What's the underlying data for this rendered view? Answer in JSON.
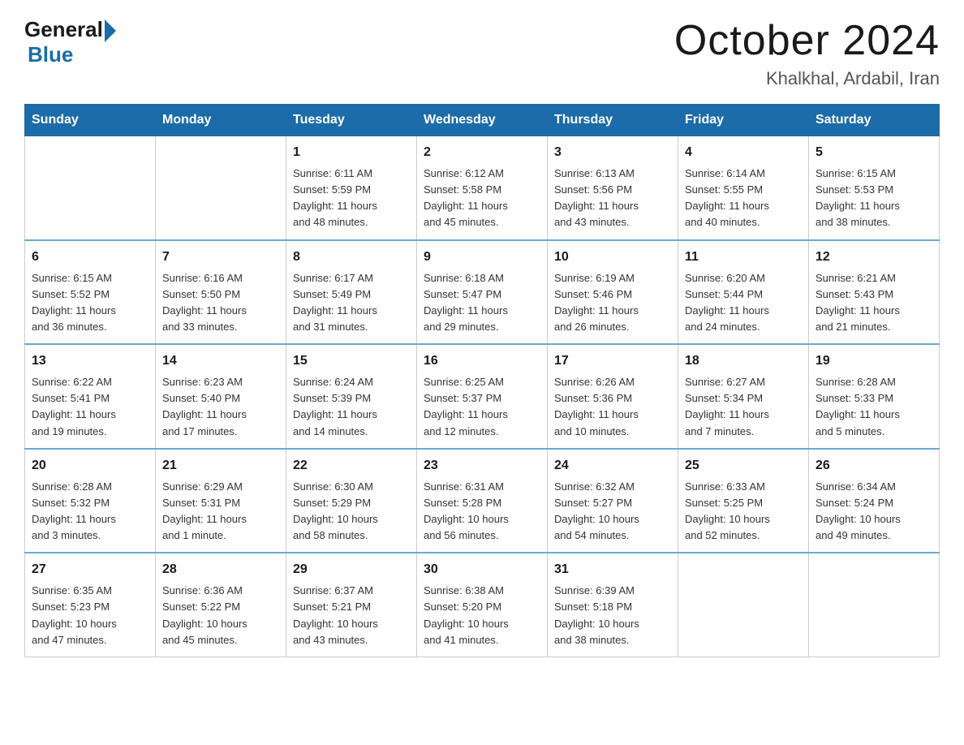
{
  "header": {
    "logo_general": "General",
    "logo_blue": "Blue",
    "title": "October 2024",
    "subtitle": "Khalkhal, Ardabil, Iran"
  },
  "weekdays": [
    "Sunday",
    "Monday",
    "Tuesday",
    "Wednesday",
    "Thursday",
    "Friday",
    "Saturday"
  ],
  "weeks": [
    [
      {
        "day": "",
        "info": ""
      },
      {
        "day": "",
        "info": ""
      },
      {
        "day": "1",
        "info": "Sunrise: 6:11 AM\nSunset: 5:59 PM\nDaylight: 11 hours\nand 48 minutes."
      },
      {
        "day": "2",
        "info": "Sunrise: 6:12 AM\nSunset: 5:58 PM\nDaylight: 11 hours\nand 45 minutes."
      },
      {
        "day": "3",
        "info": "Sunrise: 6:13 AM\nSunset: 5:56 PM\nDaylight: 11 hours\nand 43 minutes."
      },
      {
        "day": "4",
        "info": "Sunrise: 6:14 AM\nSunset: 5:55 PM\nDaylight: 11 hours\nand 40 minutes."
      },
      {
        "day": "5",
        "info": "Sunrise: 6:15 AM\nSunset: 5:53 PM\nDaylight: 11 hours\nand 38 minutes."
      }
    ],
    [
      {
        "day": "6",
        "info": "Sunrise: 6:15 AM\nSunset: 5:52 PM\nDaylight: 11 hours\nand 36 minutes."
      },
      {
        "day": "7",
        "info": "Sunrise: 6:16 AM\nSunset: 5:50 PM\nDaylight: 11 hours\nand 33 minutes."
      },
      {
        "day": "8",
        "info": "Sunrise: 6:17 AM\nSunset: 5:49 PM\nDaylight: 11 hours\nand 31 minutes."
      },
      {
        "day": "9",
        "info": "Sunrise: 6:18 AM\nSunset: 5:47 PM\nDaylight: 11 hours\nand 29 minutes."
      },
      {
        "day": "10",
        "info": "Sunrise: 6:19 AM\nSunset: 5:46 PM\nDaylight: 11 hours\nand 26 minutes."
      },
      {
        "day": "11",
        "info": "Sunrise: 6:20 AM\nSunset: 5:44 PM\nDaylight: 11 hours\nand 24 minutes."
      },
      {
        "day": "12",
        "info": "Sunrise: 6:21 AM\nSunset: 5:43 PM\nDaylight: 11 hours\nand 21 minutes."
      }
    ],
    [
      {
        "day": "13",
        "info": "Sunrise: 6:22 AM\nSunset: 5:41 PM\nDaylight: 11 hours\nand 19 minutes."
      },
      {
        "day": "14",
        "info": "Sunrise: 6:23 AM\nSunset: 5:40 PM\nDaylight: 11 hours\nand 17 minutes."
      },
      {
        "day": "15",
        "info": "Sunrise: 6:24 AM\nSunset: 5:39 PM\nDaylight: 11 hours\nand 14 minutes."
      },
      {
        "day": "16",
        "info": "Sunrise: 6:25 AM\nSunset: 5:37 PM\nDaylight: 11 hours\nand 12 minutes."
      },
      {
        "day": "17",
        "info": "Sunrise: 6:26 AM\nSunset: 5:36 PM\nDaylight: 11 hours\nand 10 minutes."
      },
      {
        "day": "18",
        "info": "Sunrise: 6:27 AM\nSunset: 5:34 PM\nDaylight: 11 hours\nand 7 minutes."
      },
      {
        "day": "19",
        "info": "Sunrise: 6:28 AM\nSunset: 5:33 PM\nDaylight: 11 hours\nand 5 minutes."
      }
    ],
    [
      {
        "day": "20",
        "info": "Sunrise: 6:28 AM\nSunset: 5:32 PM\nDaylight: 11 hours\nand 3 minutes."
      },
      {
        "day": "21",
        "info": "Sunrise: 6:29 AM\nSunset: 5:31 PM\nDaylight: 11 hours\nand 1 minute."
      },
      {
        "day": "22",
        "info": "Sunrise: 6:30 AM\nSunset: 5:29 PM\nDaylight: 10 hours\nand 58 minutes."
      },
      {
        "day": "23",
        "info": "Sunrise: 6:31 AM\nSunset: 5:28 PM\nDaylight: 10 hours\nand 56 minutes."
      },
      {
        "day": "24",
        "info": "Sunrise: 6:32 AM\nSunset: 5:27 PM\nDaylight: 10 hours\nand 54 minutes."
      },
      {
        "day": "25",
        "info": "Sunrise: 6:33 AM\nSunset: 5:25 PM\nDaylight: 10 hours\nand 52 minutes."
      },
      {
        "day": "26",
        "info": "Sunrise: 6:34 AM\nSunset: 5:24 PM\nDaylight: 10 hours\nand 49 minutes."
      }
    ],
    [
      {
        "day": "27",
        "info": "Sunrise: 6:35 AM\nSunset: 5:23 PM\nDaylight: 10 hours\nand 47 minutes."
      },
      {
        "day": "28",
        "info": "Sunrise: 6:36 AM\nSunset: 5:22 PM\nDaylight: 10 hours\nand 45 minutes."
      },
      {
        "day": "29",
        "info": "Sunrise: 6:37 AM\nSunset: 5:21 PM\nDaylight: 10 hours\nand 43 minutes."
      },
      {
        "day": "30",
        "info": "Sunrise: 6:38 AM\nSunset: 5:20 PM\nDaylight: 10 hours\nand 41 minutes."
      },
      {
        "day": "31",
        "info": "Sunrise: 6:39 AM\nSunset: 5:18 PM\nDaylight: 10 hours\nand 38 minutes."
      },
      {
        "day": "",
        "info": ""
      },
      {
        "day": "",
        "info": ""
      }
    ]
  ]
}
